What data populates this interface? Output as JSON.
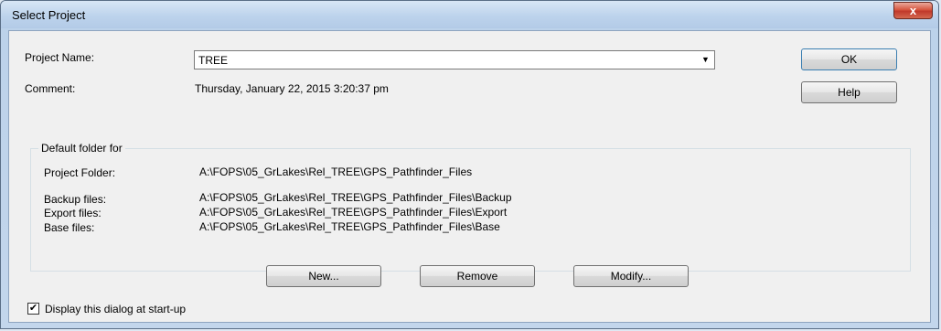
{
  "window": {
    "title": "Select Project",
    "close_symbol": "x"
  },
  "project": {
    "name_label": "Project Name:",
    "name_value": "TREE",
    "comment_label": "Comment:",
    "comment_value": "Thursday, January 22, 2015 3:20:37 pm"
  },
  "buttons": {
    "ok": "OK",
    "help": "Help",
    "new": "New...",
    "remove": "Remove",
    "modify": "Modify..."
  },
  "folders": {
    "group_title": "Default folder for",
    "project_label": "Project Folder:",
    "project_value": "A:\\FOPS\\05_GrLakes\\Rel_TREE\\GPS_Pathfinder_Files",
    "backup_label": "Backup files:",
    "backup_value": "A:\\FOPS\\05_GrLakes\\Rel_TREE\\GPS_Pathfinder_Files\\Backup",
    "export_label": "Export files:",
    "export_value": "A:\\FOPS\\05_GrLakes\\Rel_TREE\\GPS_Pathfinder_Files\\Export",
    "base_label": "Base files:",
    "base_value": "A:\\FOPS\\05_GrLakes\\Rel_TREE\\GPS_Pathfinder_Files\\Base"
  },
  "startup": {
    "checked": true,
    "check_mark": "✔",
    "label": "Display this dialog at start-up"
  },
  "icons": {
    "dropdown": "▼"
  }
}
